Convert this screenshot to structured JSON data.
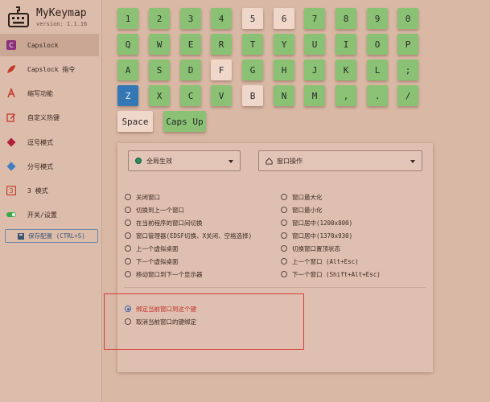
{
  "app": {
    "title": "MyKeymap",
    "version": "version: 1.1.16"
  },
  "sidebar": {
    "items": [
      {
        "label": "Capslock",
        "icon": "capslock-icon",
        "color": "#8a2f7a"
      },
      {
        "label": "Capslock 指令",
        "icon": "rocket-icon",
        "color": "#c23a2a"
      },
      {
        "label": "缩写功能",
        "icon": "letter-a-icon",
        "color": "#c23a2a"
      },
      {
        "label": "自定义热键",
        "icon": "edit-icon",
        "color": "#c23a2a"
      },
      {
        "label": "逗号模式",
        "icon": "diamond-icon",
        "color": "#b0223a"
      },
      {
        "label": "分号模式",
        "icon": "diamond-icon",
        "color": "#3f7fbf"
      },
      {
        "label": "3 模式",
        "icon": "number-3-icon",
        "color": "#c23a2a"
      },
      {
        "label": "开关/设置",
        "icon": "toggle-icon",
        "color": "#3aa84a"
      }
    ],
    "save_label": "保存配置 (CTRL+S)"
  },
  "keyboard": {
    "rows": [
      [
        "1",
        "2",
        "3",
        "4",
        "5",
        "6",
        "7",
        "8",
        "9",
        "0"
      ],
      [
        "Q",
        "W",
        "E",
        "R",
        "T",
        "Y",
        "U",
        "I",
        "O",
        "P"
      ],
      [
        "A",
        "S",
        "D",
        "F",
        "G",
        "H",
        "J",
        "K",
        "L",
        ";"
      ],
      [
        "Z",
        "X",
        "C",
        "V",
        "B",
        "N",
        "M",
        ",",
        ".",
        "/"
      ]
    ],
    "extra": [
      "Space",
      "Caps Up"
    ],
    "selected_key": "Z",
    "unmapped_keys": [
      "5",
      "6",
      "F",
      "B"
    ],
    "colors": {
      "mapped": "#8ac174",
      "unmapped": "#efd7c9",
      "selected": "#3378b5"
    }
  },
  "panel": {
    "scope_select": "全局生效",
    "category_select": "窗口操作",
    "left_options": [
      "关闭窗口",
      "切换到上一个窗口",
      "在当前程序的窗口间切换",
      "窗口管理器(EDSF切换、X关闭、空格选择)",
      "上一个虚拟桌面",
      "下一个虚拟桌面",
      "移动窗口到下一个显示器"
    ],
    "right_options": [
      "窗口最大化",
      "窗口最小化",
      "窗口居中(1200x800)",
      "窗口居中(1370x930)",
      "切换窗口置顶状态",
      "上一个窗口 (Alt+Esc)",
      "下一个窗口 (Shift+Alt+Esc)"
    ],
    "bind_options": [
      "绑定当前窗口到这个键",
      "取消当前窗口的键绑定"
    ],
    "selected_bind_option": 0
  }
}
